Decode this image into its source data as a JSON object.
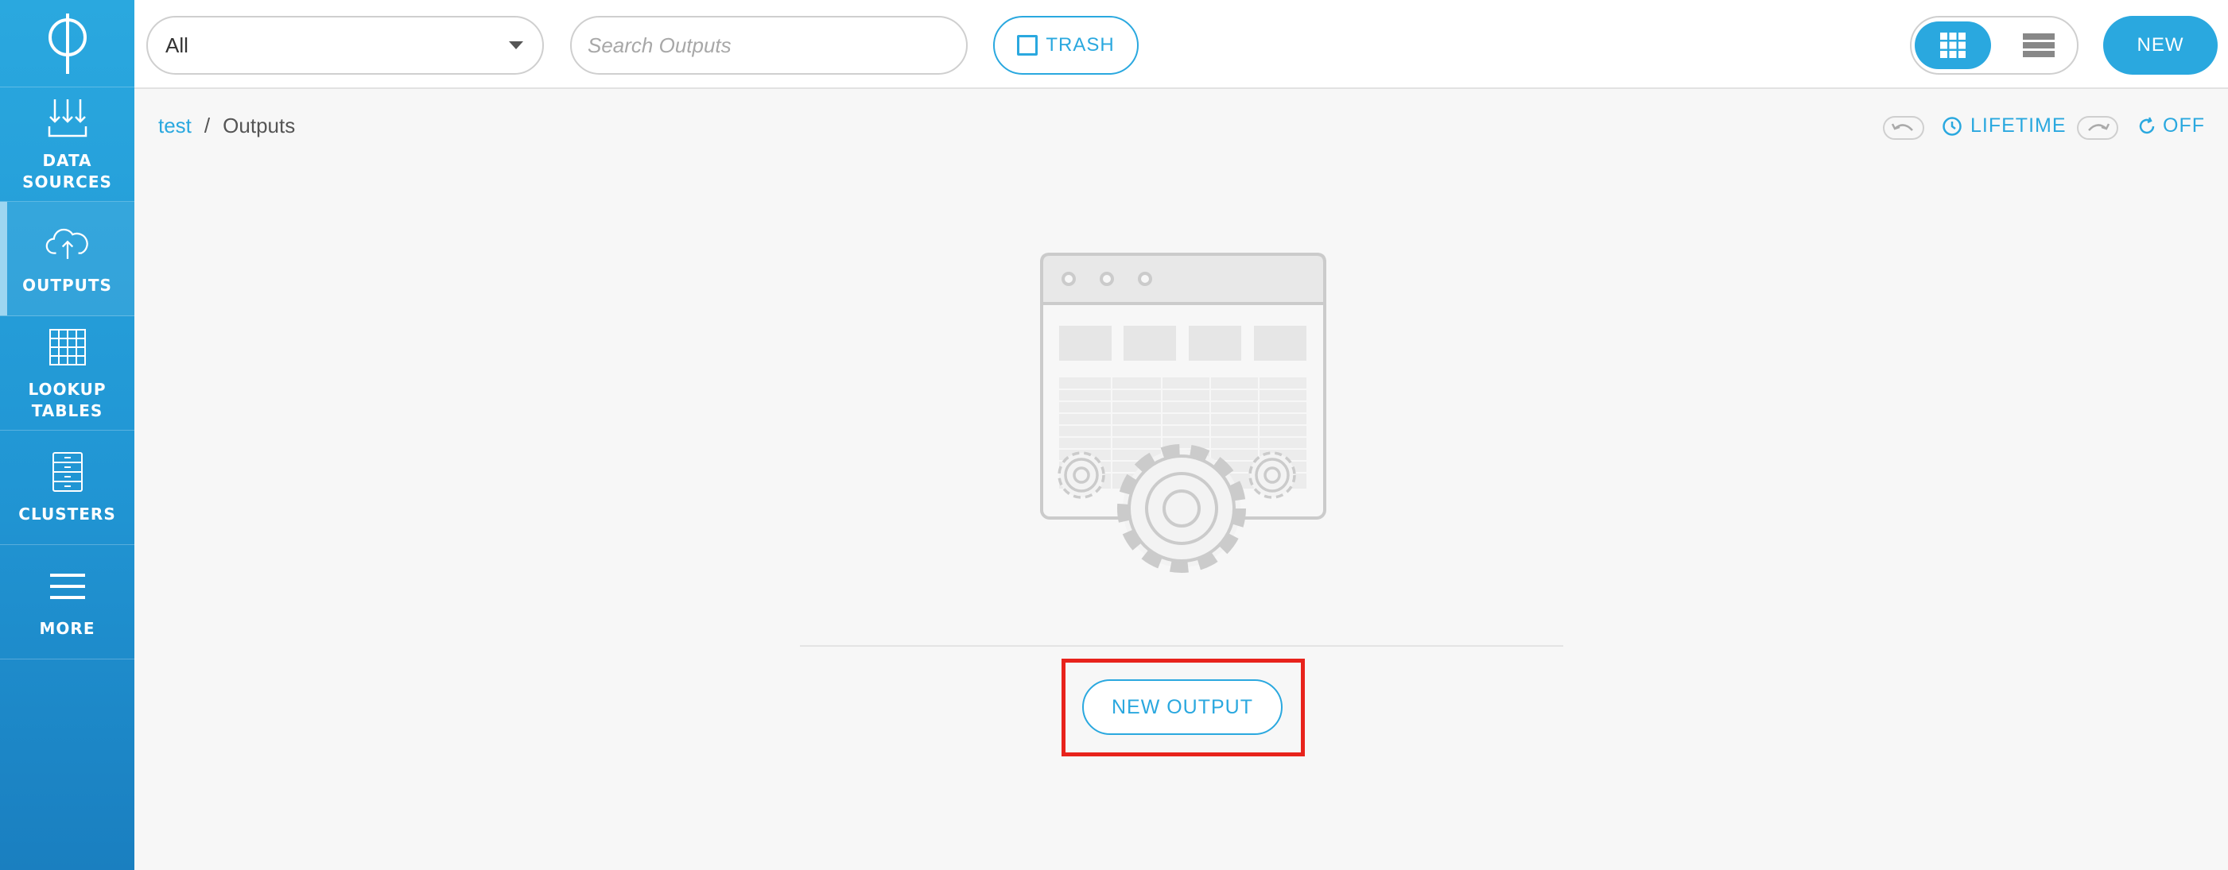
{
  "sidebar": {
    "logo": "φ",
    "items": [
      {
        "label": "DATA\nSOURCES",
        "icon": "data-sources-icon"
      },
      {
        "label": "OUTPUTS",
        "icon": "cloud-upload-icon",
        "active": true
      },
      {
        "label": "LOOKUP\nTABLES",
        "icon": "table-grid-icon"
      },
      {
        "label": "CLUSTERS",
        "icon": "server-rack-icon"
      },
      {
        "label": "MORE",
        "icon": "hamburger-menu-icon"
      }
    ]
  },
  "toolbar": {
    "filter_value": "All",
    "search_placeholder": "Search Outputs",
    "trash_label": "TRASH",
    "new_label": "NEW"
  },
  "breadcrumb": {
    "project": "test",
    "separator": "/",
    "current": "Outputs"
  },
  "controls": {
    "lifetime_label": "LIFETIME",
    "refresh_label": "OFF"
  },
  "empty_state": {
    "button_label": "NEW OUTPUT"
  },
  "colors": {
    "accent": "#2aa8df",
    "highlight": "#e8231c"
  }
}
